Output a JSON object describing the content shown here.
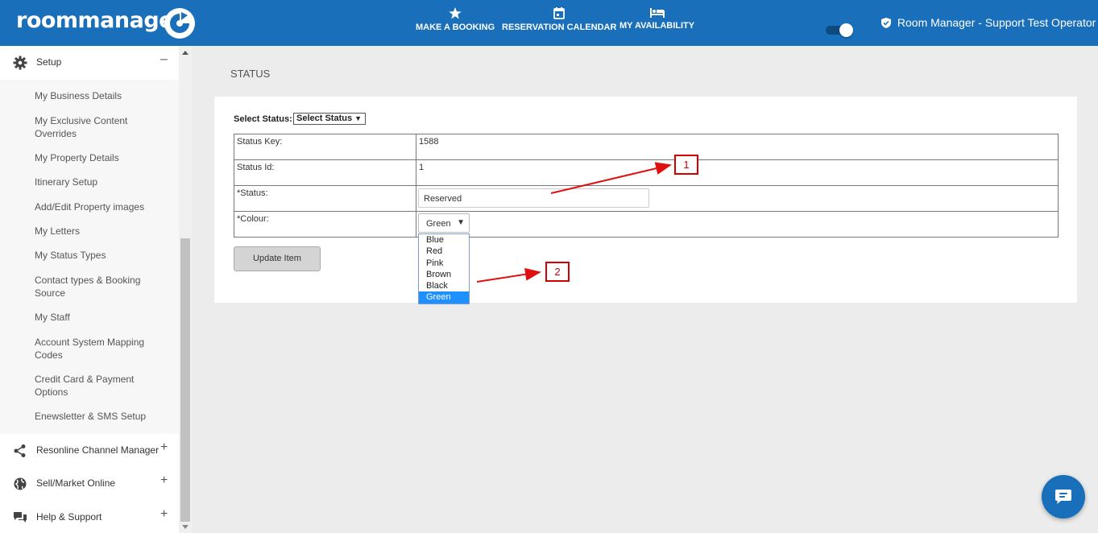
{
  "header": {
    "logo_text": "roommanager",
    "nav": [
      {
        "label": "MAKE A BOOKING",
        "icon": "star-icon"
      },
      {
        "label": "RESERVATION CALENDAR",
        "icon": "calendar-icon"
      },
      {
        "label": "MY AVAILABILITY",
        "icon": "bed-icon"
      }
    ],
    "operator": "Room Manager - Support Test Operator",
    "colors": {
      "brand": "#1a6fba"
    }
  },
  "sidebar": {
    "setup": {
      "label": "Setup",
      "toggle": "–",
      "icon": "gear-icon"
    },
    "setup_items": [
      "My Business Details",
      "My Exclusive Content Overrides",
      "My Property Details",
      "Itinerary Setup",
      "Add/Edit Property images",
      "My Letters",
      "My Status Types",
      "Contact types & Booking Source",
      "My Staff",
      "Account System Mapping Codes",
      "Credit Card & Payment Options",
      "Enewsletter & SMS Setup"
    ],
    "sections": [
      {
        "label": "Resonline Channel Manager",
        "toggle": "+",
        "icon": "share-icon"
      },
      {
        "label": "Sell/Market Online",
        "toggle": "+",
        "icon": "globe-icon"
      },
      {
        "label": "Help & Support",
        "toggle": "+",
        "icon": "chat-bubbles-icon"
      }
    ]
  },
  "main": {
    "title": "STATUS",
    "select_status_label": "Select Status:",
    "select_status_value": "Select Status",
    "rows": [
      {
        "key": "Status Key:",
        "value": "1588"
      },
      {
        "key": "Status Id:",
        "value": "1"
      },
      {
        "key": "*Status:",
        "value": ""
      },
      {
        "key": "*Colour:",
        "value": ""
      }
    ],
    "status_input_value": "Reserved",
    "colour_selected": "Green",
    "colour_options": [
      "Blue",
      "Red",
      "Pink",
      "Brown",
      "Black",
      "Green"
    ],
    "update_button": "Update Item"
  },
  "annotations": {
    "one": "1",
    "two": "2",
    "color": "#d40000"
  }
}
